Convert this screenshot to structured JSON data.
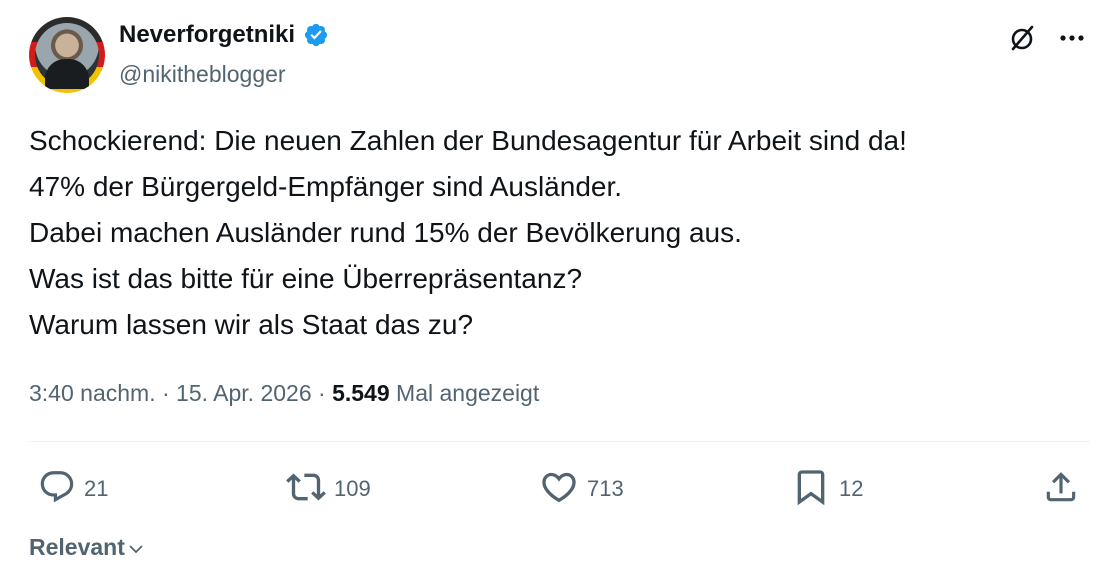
{
  "author": {
    "display_name": "Neverforgetniki",
    "handle": "@nikitheblogger",
    "verified": true
  },
  "header_icons": [
    "grok-icon",
    "more-icon"
  ],
  "tweet": {
    "lines": [
      "Schockierend: Die neuen Zahlen der Bundesagentur für Arbeit sind da!",
      "47% der Bürgergeld-Empfänger sind Ausländer.",
      "Dabei machen Ausländer rund 15% der Bevölkerung aus.",
      "Was ist das bitte für eine Überrepräsentanz?",
      "Warum lassen wir als Staat das zu?"
    ]
  },
  "meta": {
    "time": "3:40 nachm.",
    "separator": "·",
    "date": "15. Apr. 2026",
    "views_count": "5.549",
    "views_label": "Mal angezeigt"
  },
  "actions": {
    "replies": "21",
    "reposts": "109",
    "likes": "713",
    "bookmarks": "12"
  },
  "sort": {
    "label": "Relevant"
  },
  "colors": {
    "text": "#0f1419",
    "secondary": "#536471",
    "verified": "#1d9bf0",
    "divider": "#eff3f4"
  }
}
